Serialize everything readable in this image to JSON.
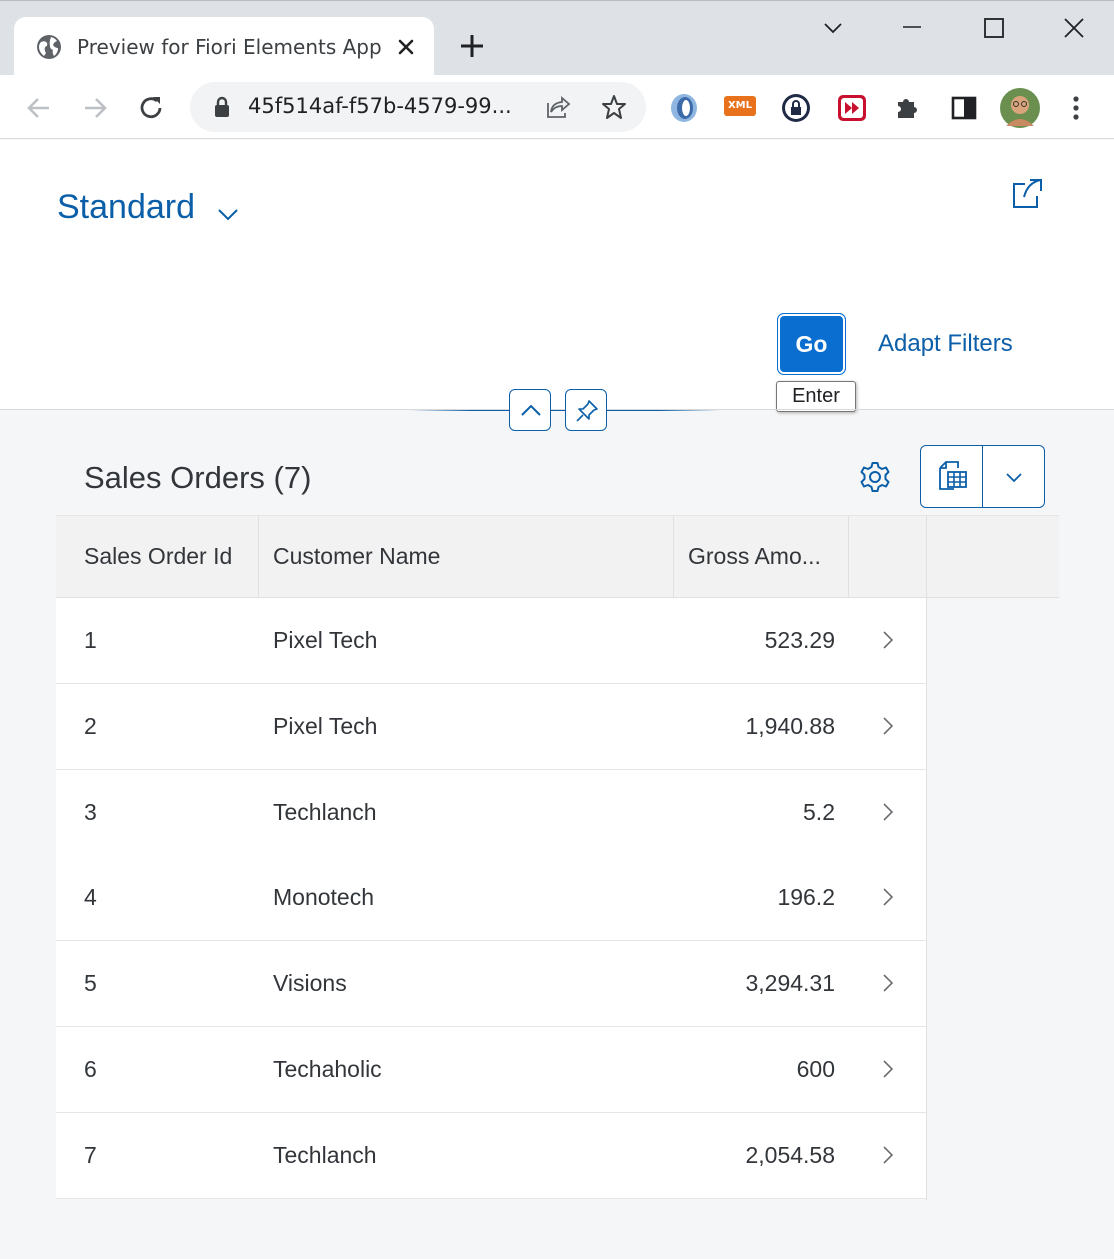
{
  "browser": {
    "tab_title": "Preview for Fiori Elements App",
    "url": "45f514af-f57b-4579-99...",
    "extensions": [
      "sapui5-inspector-icon",
      "xml-viewer-icon",
      "password-manager-icon",
      "video-speed-icon",
      "extensions-puzzle-icon",
      "side-panel-icon",
      "profile-avatar"
    ],
    "xml_label": "XML"
  },
  "header": {
    "variant": "Standard",
    "go_label": "Go",
    "adapt_filters_label": "Adapt Filters",
    "tooltip": "Enter"
  },
  "table": {
    "title": "Sales Orders (7)",
    "columns": [
      "Sales Order Id",
      "Customer Name",
      "Gross Amo..."
    ],
    "rows": [
      {
        "id": "1",
        "customer": "Pixel Tech",
        "amount": "523.29"
      },
      {
        "id": "2",
        "customer": "Pixel Tech",
        "amount": "1,940.88"
      },
      {
        "id": "3",
        "customer": "Techlanch",
        "amount": "5.2"
      },
      {
        "id": "4",
        "customer": "Monotech",
        "amount": "196.2"
      },
      {
        "id": "5",
        "customer": "Visions",
        "amount": "3,294.31"
      },
      {
        "id": "6",
        "customer": "Techaholic",
        "amount": "600"
      },
      {
        "id": "7",
        "customer": "Techlanch",
        "amount": "2,054.58"
      }
    ]
  },
  "colors": {
    "brand_blue": "#0a6ed1",
    "link_blue": "#0b5ea8",
    "text": "#32363a"
  }
}
